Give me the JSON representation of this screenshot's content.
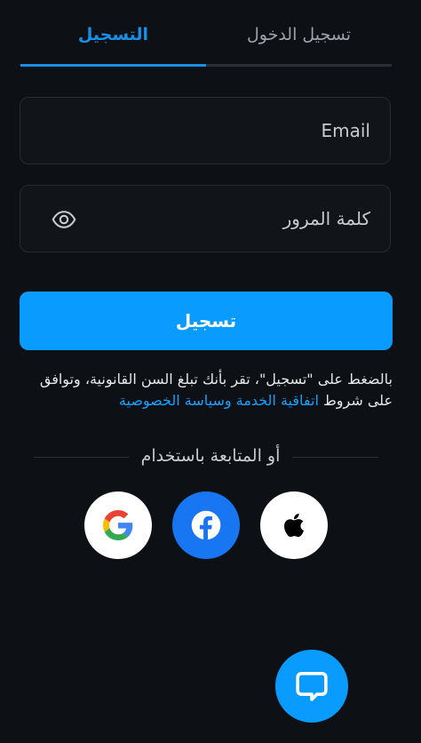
{
  "tabs": {
    "signup": "التسجيل",
    "login": "تسجيل الدخول"
  },
  "form": {
    "email_placeholder": "Email",
    "password_placeholder": "كلمة المرور",
    "submit_label": "تسجيل"
  },
  "terms": {
    "text": "بالضغط على \"تسجيل\"، تقر بأنك تبلغ السن القانونية، وتوافق على شروط ",
    "link": "اتفاقية الخدمة وسياسة الخصوصية"
  },
  "divider": "أو المتابعة باستخدام",
  "social": [
    "google-icon",
    "facebook-icon",
    "apple-icon"
  ],
  "colors": {
    "background": "#0d1014",
    "accent": "#0a9bff",
    "active_tab": "#1a8fe6",
    "facebook": "#1976f2"
  }
}
